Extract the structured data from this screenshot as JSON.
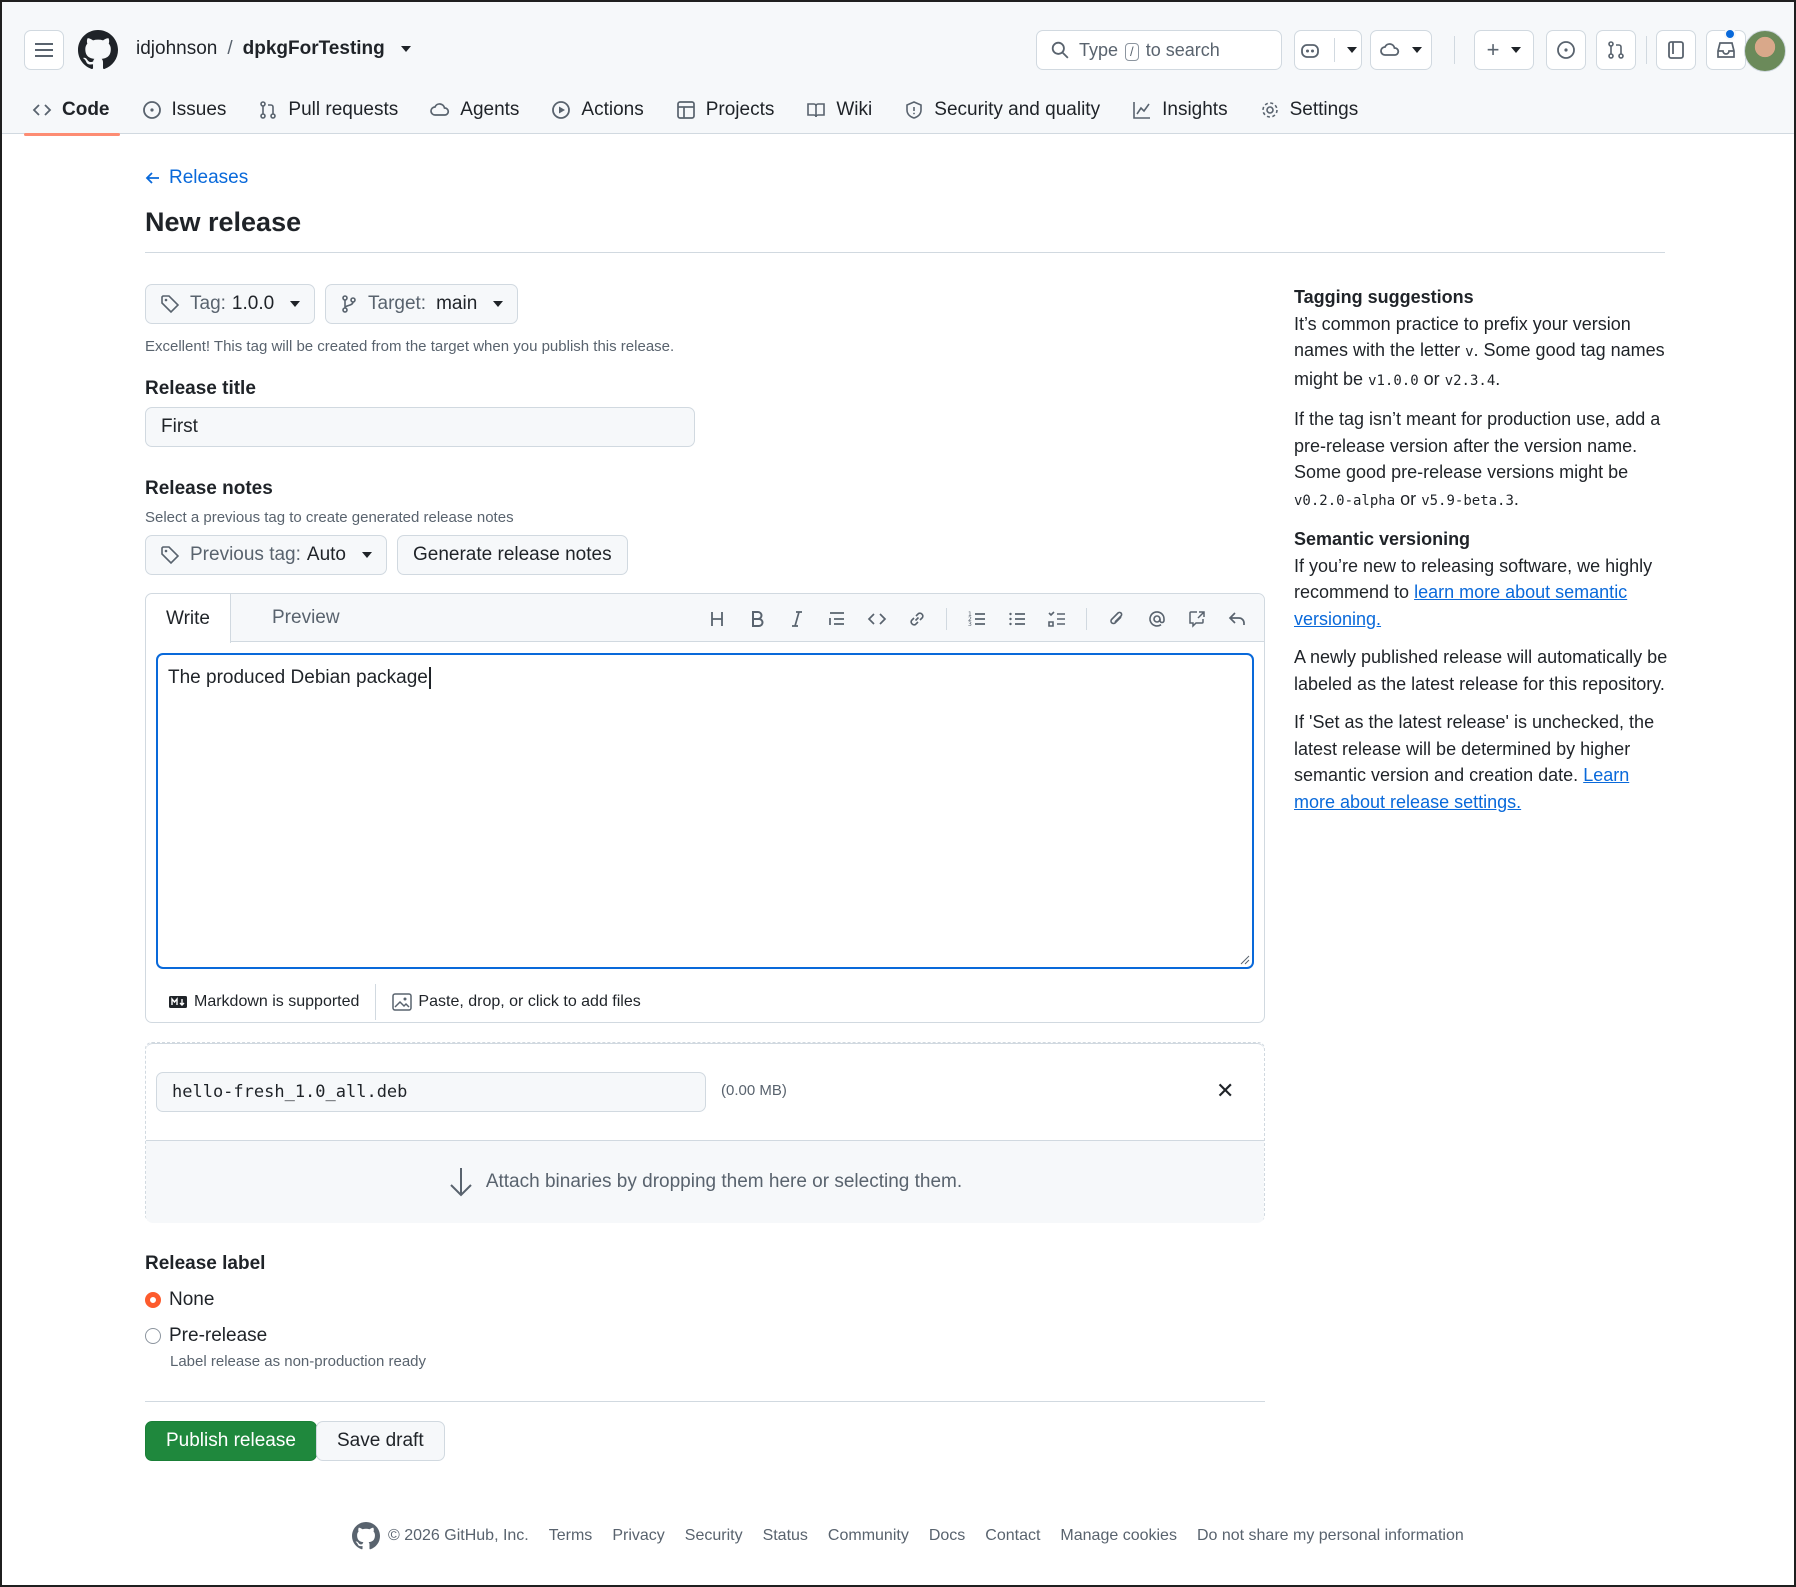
{
  "header": {
    "owner": "idjohnson",
    "separator": "/",
    "repo": "dpkgForTesting",
    "search_prefix": "Type",
    "search_key": "/",
    "search_suffix": "to search"
  },
  "tabs": [
    {
      "label": "Code",
      "icon": "code-icon"
    },
    {
      "label": "Issues",
      "icon": "issue-icon"
    },
    {
      "label": "Pull requests",
      "icon": "pull-request-icon"
    },
    {
      "label": "Agents",
      "icon": "agent-icon"
    },
    {
      "label": "Actions",
      "icon": "play-icon"
    },
    {
      "label": "Projects",
      "icon": "table-icon"
    },
    {
      "label": "Wiki",
      "icon": "book-icon"
    },
    {
      "label": "Security and quality",
      "icon": "shield-icon"
    },
    {
      "label": "Insights",
      "icon": "graph-icon"
    },
    {
      "label": "Settings",
      "icon": "gear-icon"
    }
  ],
  "page": {
    "back_link": "Releases",
    "title": "New release"
  },
  "release": {
    "tag_label": "Tag:",
    "tag_value": "1.0.0",
    "target_label": "Target:",
    "target_value": "main",
    "tag_hint": "Excellent! This tag will be created from the target when you publish this release.",
    "title_label": "Release title",
    "title_value": "First",
    "notes_label": "Release notes",
    "notes_hint": "Select a previous tag to create generated release notes",
    "prev_tag_label": "Previous tag:",
    "prev_tag_value": "Auto",
    "generate_label": "Generate release notes"
  },
  "editor": {
    "write_tab": "Write",
    "preview_tab": "Preview",
    "body": "The produced Debian package",
    "markdown_note": "Markdown is supported",
    "files_note": "Paste, drop, or click to add files"
  },
  "attachments": {
    "file_name": "hello-fresh_1.0_all.deb",
    "file_size": "(0.00 MB)",
    "drop_text": "Attach binaries by dropping them here or selecting them."
  },
  "label_section": {
    "heading": "Release label",
    "options": [
      {
        "label": "None",
        "selected": true
      },
      {
        "label": "Pre-release",
        "selected": false,
        "description": "Label release as non-production ready"
      }
    ]
  },
  "actions": {
    "publish": "Publish release",
    "draft": "Save draft"
  },
  "sidebar": {
    "tagging_heading": "Tagging suggestions",
    "tagging_p1_a": "It’s common practice to prefix your version names with the letter",
    "tagging_p1_v": "v",
    "tagging_p1_b": ". Some good tag names might be",
    "tagging_p1_c1": "v1.0.0",
    "tagging_p1_or": "or",
    "tagging_p1_c2": "v2.3.4",
    "tagging_p2_a": "If the tag isn’t meant for production use, add a pre-release version after the version name. Some good pre-release versions might be",
    "tagging_p2_c1": "v0.2.0-alpha",
    "tagging_p2_or": "or",
    "tagging_p2_c2": "v5.9-beta.3",
    "semver_heading": "Semantic versioning",
    "semver_p1_a": "If you’re new to releasing software, we highly recommend to",
    "semver_p1_link": "learn more about semantic versioning.",
    "semver_p2": "A newly published release will automatically be labeled as the latest release for this repository.",
    "semver_p3_a": "If 'Set as the latest release' is unchecked, the latest release will be determined by higher semantic version and creation date.",
    "semver_p3_link": "Learn more about release settings."
  },
  "footer": {
    "copyright": "© 2026 GitHub, Inc.",
    "links": [
      "Terms",
      "Privacy",
      "Security",
      "Status",
      "Community",
      "Docs",
      "Contact",
      "Manage cookies",
      "Do not share my personal information"
    ]
  },
  "colors": {
    "accent": "#0969da",
    "primary_button": "#1f883d",
    "tab_underline": "#fd8c73",
    "radio_selected": "#fd5b2d"
  }
}
